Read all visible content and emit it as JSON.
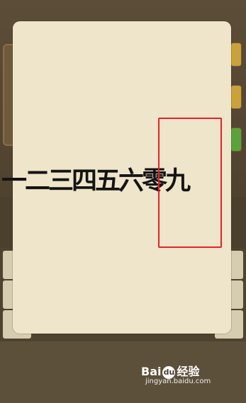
{
  "puzzle": {
    "characters": "一二三四五六零九"
  },
  "colors": {
    "card": "#efe5ca",
    "highlight_box": "#e8202a",
    "background": "#4b3f2e"
  },
  "watermark": {
    "brand_left": "Bai",
    "brand_right": "经验",
    "paw": "du",
    "url": "jingyan.baidu.com"
  }
}
